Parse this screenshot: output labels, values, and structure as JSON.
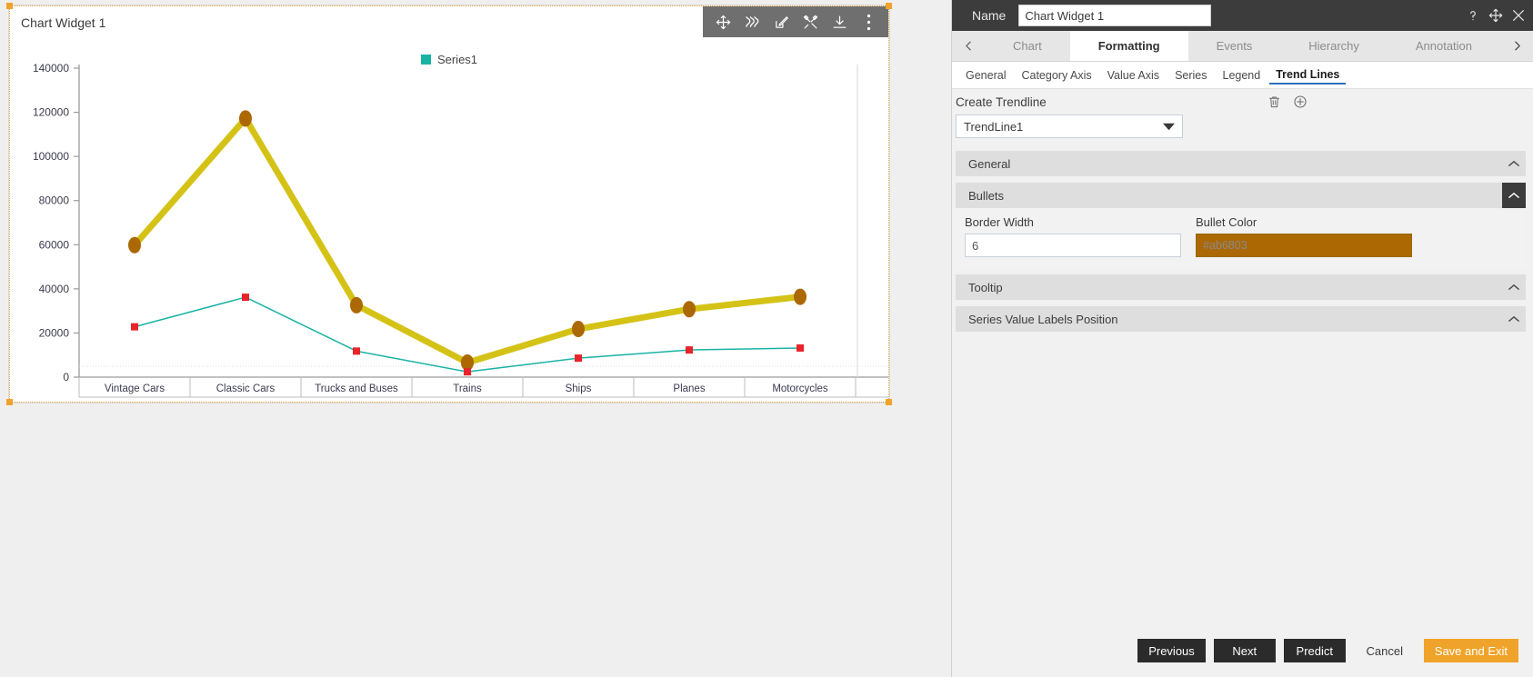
{
  "widget": {
    "title": "Chart Widget 1",
    "toolbar": [
      {
        "name": "move-icon",
        "label": "Move"
      },
      {
        "name": "squiggle-icon",
        "label": "Draw"
      },
      {
        "name": "edit-icon",
        "label": "Edit"
      },
      {
        "name": "tools-icon",
        "label": "Tools"
      },
      {
        "name": "download-icon",
        "label": "Download"
      },
      {
        "name": "more-options-icon",
        "label": "More"
      }
    ]
  },
  "chart_data": {
    "type": "line",
    "title": "",
    "subtitle": "",
    "xlabel": "",
    "ylabel": "",
    "categories": [
      "Vintage Cars",
      "Classic Cars",
      "Trucks and Buses",
      "Trains",
      "Ships",
      "Planes",
      "Motorcycles"
    ],
    "ylim": [
      0,
      140000
    ],
    "yticks": [
      0,
      20000,
      40000,
      60000,
      80000,
      100000,
      120000,
      140000
    ],
    "grid": false,
    "legend": {
      "position": "top",
      "entries": [
        "Series1"
      ]
    },
    "series": [
      {
        "name": "Series1",
        "color": "#19b3a6",
        "marker": "square",
        "marker_color": "#e8232a",
        "line_width": 1.5,
        "values": [
          22800,
          36200,
          11800,
          2400,
          8600,
          12300,
          13200
        ]
      },
      {
        "name": "TrendLine1",
        "color": "#d4c316",
        "marker": "circle",
        "marker_color": "#ab6803",
        "line_width": 7,
        "values": [
          59800,
          117200,
          32600,
          6600,
          21800,
          30800,
          36400
        ]
      }
    ]
  },
  "panel": {
    "header": {
      "name_label": "Name",
      "name_value": "Chart Widget 1",
      "help_icon": "help-icon",
      "move_icon": "move-icon",
      "close_icon": "close-icon"
    },
    "tabs": {
      "prev_arrow": "chevron-left-icon",
      "next_arrow": "chevron-right-icon",
      "items": [
        {
          "label": "Chart",
          "active": false
        },
        {
          "label": "Formatting",
          "active": true
        },
        {
          "label": "Events",
          "active": false
        },
        {
          "label": "Hierarchy",
          "active": false
        },
        {
          "label": "Annotation",
          "active": false
        }
      ]
    },
    "subtabs": [
      {
        "label": "General",
        "active": false
      },
      {
        "label": "Category Axis",
        "active": false
      },
      {
        "label": "Value Axis",
        "active": false
      },
      {
        "label": "Series",
        "active": false
      },
      {
        "label": "Legend",
        "active": false
      },
      {
        "label": "Trend Lines",
        "active": true
      }
    ],
    "create_trendline": {
      "label": "Create Trendline",
      "delete_icon": "trash-icon",
      "add_icon": "plus-circle-icon",
      "selected": "TrendLine1"
    },
    "sections": [
      {
        "label": "General",
        "expanded": false
      },
      {
        "label": "Bullets",
        "expanded": true
      },
      {
        "label": "Tooltip",
        "expanded": false
      },
      {
        "label": "Series Value Labels Position",
        "expanded": false
      }
    ],
    "bullets": {
      "border_width_label": "Border Width",
      "border_width_value": "6",
      "bullet_color_label": "Bullet Color",
      "bullet_color_value": "#ab6803"
    },
    "footer": {
      "previous": "Previous",
      "next": "Next",
      "predict": "Predict",
      "cancel": "Cancel",
      "save_exit": "Save and Exit"
    }
  }
}
